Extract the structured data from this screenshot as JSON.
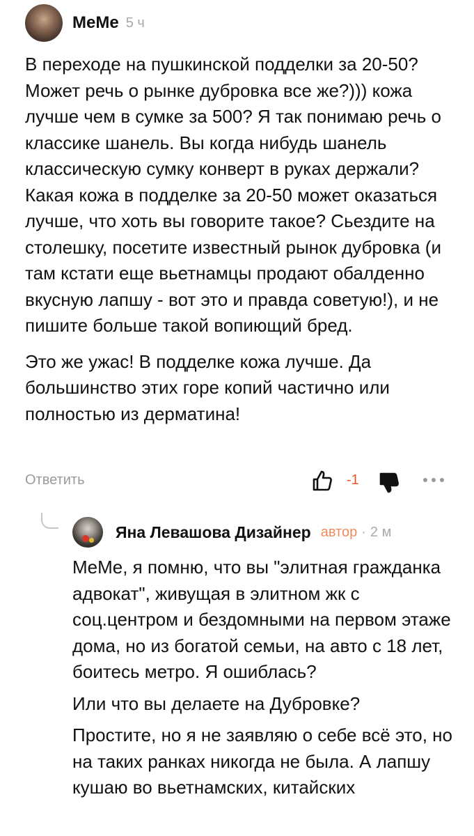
{
  "comment": {
    "author": "MeMe",
    "time": "5 ч",
    "paragraphs": [
      "В переходе на пушкинской подделки за 20-50? Может речь о рынке дубровка все же?))) кожа лучше чем в сумке за 500? Я так понимаю речь о классике шанель. Вы когда нибудь шанель классическую сумку конверт в руках держали? Какая кожа в подделке за 20-50 может оказаться лучше, что хоть вы говорите такое? Сьездите на столешку, посетите известный рынок дубровка (и там кстати еще вьетнамцы продают обалденно вкусную лапшу - вот это и правда советую!), и не пишите больше такой вопиющий бред.",
      "Это же ужас! В подделке кожа лучше. Да большинство этих горе копий частично или полностью из дерматина!"
    ],
    "reply_label": "Ответить",
    "score": "-1",
    "colors": {
      "score": "#e8542c",
      "muted": "#9a9a9a"
    },
    "icons": [
      "like-icon",
      "dislike-icon",
      "more-icon"
    ]
  },
  "reply": {
    "author": "Яна Левашова Дизайнер",
    "badge": "автор",
    "time": "2 м",
    "paragraphs": [
      "MeMe, я помню, что вы \"элитная гражданка адвокат\", живущая в элитном жк с соц.центром и бездомными на первом этаже дома, но из богатой семьи, на авто с 18 лет, боитесь метро. Я ошиблась?",
      "Или что вы делаете на Дубровке?",
      "Простите, но я не заявляю о себе всё это, но на таких ранках никогда не была. А лапшу кушаю во вьетнамских, китайских"
    ],
    "colors": {
      "badge": "#f08a5d"
    }
  }
}
